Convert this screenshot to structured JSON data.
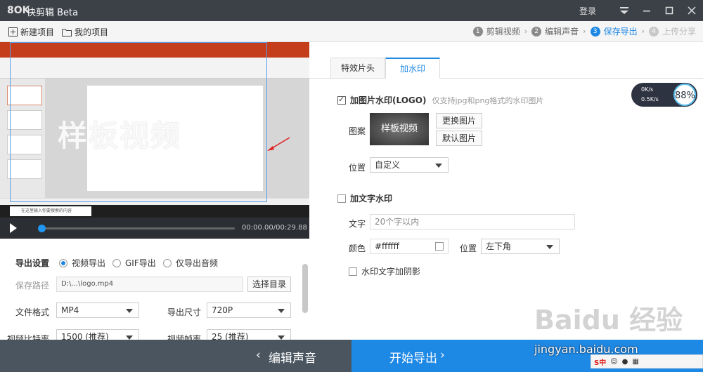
{
  "app": {
    "logo": "8OK",
    "name": "快剪辑 Beta",
    "login": "登录"
  },
  "toolbar": {
    "new_project": "新建项目",
    "my_projects": "我的项目"
  },
  "steps": [
    {
      "num": "1",
      "label": "剪辑视频"
    },
    {
      "num": "2",
      "label": "编辑声音"
    },
    {
      "num": "3",
      "label": "保存导出"
    },
    {
      "num": "4",
      "label": "上传分享"
    }
  ],
  "preview": {
    "watermark_text": "样板视频",
    "search_placeholder": "在这里输入你要搜索的内容"
  },
  "player": {
    "time": "00:00.00/00:29.88"
  },
  "export": {
    "title": "导出设置",
    "options": [
      "视频导出",
      "GIF导出",
      "仅导出音频"
    ],
    "save_path_label": "保存路径",
    "save_path_value": "D:\\...\\logo.mp4",
    "choose_dir": "选择目录",
    "format_label": "文件格式",
    "format_value": "MP4",
    "size_label": "导出尺寸",
    "size_value": "720P",
    "bitrate_label": "视频比特率",
    "bitrate_value": "1500 (推荐)",
    "fps_label": "视频帧率",
    "fps_value": "25 (推荐)"
  },
  "tabs": [
    "特效片头",
    "加水印"
  ],
  "watermark": {
    "image_check": "加图片水印(LOGO)",
    "image_hint": "仅支持jpg和png格式的水印图片",
    "pattern_label": "图案",
    "pattern_text": "样板视频",
    "change_image": "更换图片",
    "default_image": "默认图片",
    "position_label": "位置",
    "position_value": "自定义",
    "text_check": "加文字水印",
    "text_label": "文字",
    "text_placeholder": "20个字以内",
    "color_label": "颜色",
    "color_value": "#ffffff",
    "text_position_label": "位置",
    "text_position_value": "左下角",
    "shadow_check": "水印文字加阴影"
  },
  "footer": {
    "back": "编辑声音",
    "start": "开始导出"
  },
  "net": {
    "up": "0K/s",
    "down": "0.5K/s",
    "pct": "88%"
  },
  "brand": {
    "baidu": "Baidu 经验",
    "jingyan": "jingyan.baidu.com"
  },
  "ime": "S中"
}
